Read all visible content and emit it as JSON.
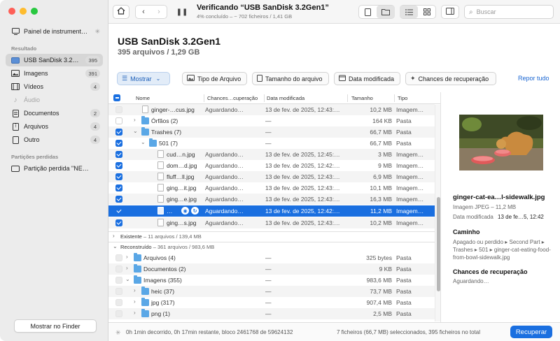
{
  "sidebar": {
    "dashboard": "Painel de instrument…",
    "results_heading": "Resultado",
    "items": [
      {
        "label": "USB  SanDisk 3.2…",
        "count": "395"
      },
      {
        "label": "Imagens",
        "count": "391"
      },
      {
        "label": "Vídeos",
        "count": "4"
      },
      {
        "label": "Áudio",
        "count": ""
      },
      {
        "label": "Documentos",
        "count": "2"
      },
      {
        "label": "Arquivos",
        "count": "4"
      },
      {
        "label": "Outro",
        "count": "4"
      }
    ],
    "lost_heading": "Partições perdidas",
    "lost_item": "Partição perdida \"NE…",
    "finder_button": "Mostrar no Finder"
  },
  "toolbar": {
    "title": "Verificando “USB  SanDisk 3.2Gen1”",
    "subtitle": "4% concluído – ~ 702 ficheiros / 1,41 GB",
    "search_placeholder": "Buscar"
  },
  "header": {
    "title": "USB  SanDisk 3.2Gen1",
    "subtitle": "395 arquivos / 1,29 GB"
  },
  "filters": {
    "show": "Mostrar",
    "type": "Tipo de Arquivo",
    "size": "Tamanho do arquivo",
    "date": "Data modificada",
    "chance": "Chances de recuperação",
    "reset": "Repor tudo"
  },
  "table": {
    "columns": {
      "name": "Nome",
      "chance": "Chances…cuperação",
      "date": "Data modificada",
      "size": "Tamanho",
      "type": "Tipo"
    },
    "rows": [
      {
        "name": "ginger-…cus.jpg",
        "chance": "Aguardando…",
        "date": "13 de fev. de 2025, 12:43:…",
        "size": "10,2 MB",
        "type": "Imagem…"
      },
      {
        "name": "Órfãos (2)",
        "chance": "",
        "date": "—",
        "size": "164 KB",
        "type": "Pasta"
      },
      {
        "name": "Trashes (7)",
        "chance": "",
        "date": "—",
        "size": "66,7 MB",
        "type": "Pasta"
      },
      {
        "name": "501 (7)",
        "chance": "",
        "date": "—",
        "size": "66,7 MB",
        "type": "Pasta"
      },
      {
        "name": "cud…n.jpg",
        "chance": "Aguardando…",
        "date": "13 de fev. de 2025, 12:45:…",
        "size": "3 MB",
        "type": "Imagem…"
      },
      {
        "name": "dom…d.jpg",
        "chance": "Aguardando…",
        "date": "13 de fev. de 2025, 12:42:…",
        "size": "9 MB",
        "type": "Imagem…"
      },
      {
        "name": "fluff…ll.jpg",
        "chance": "Aguardando…",
        "date": "13 de fev. de 2025, 12:43:…",
        "size": "6,9 MB",
        "type": "Imagem…"
      },
      {
        "name": "ging…it.jpg",
        "chance": "Aguardando…",
        "date": "13 de fev. de 2025, 12:43:…",
        "size": "10,1 MB",
        "type": "Imagem…"
      },
      {
        "name": "ging…e.jpg",
        "chance": "Aguardando…",
        "date": "13 de fev. de 2025, 12:43:…",
        "size": "16,3 MB",
        "type": "Imagem…"
      },
      {
        "name": "…",
        "chance": "Aguardando…",
        "date": "13 de fev. de 2025, 12:42:…",
        "size": "11,2 MB",
        "type": "Imagem…"
      },
      {
        "name": "ging…s.jpg",
        "chance": "Aguardando…",
        "date": "13 de fev. de 2025, 12:43:…",
        "size": "10,2 MB",
        "type": "Imagem…"
      }
    ],
    "group_existing": {
      "label": "Existente",
      "detail": " – 11 arquivos / 139,4 MB"
    },
    "group_rebuilt": {
      "label": "Reconstruído",
      "detail": " – 361 arquivos / 983,6 MB"
    },
    "rebuilt_rows": [
      {
        "name": "Arquivos (4)",
        "date": "—",
        "size": "325 bytes",
        "type": "Pasta"
      },
      {
        "name": "Documentos (2)",
        "date": "—",
        "size": "9 KB",
        "type": "Pasta"
      },
      {
        "name": "Imagens (355)",
        "date": "—",
        "size": "983,6 MB",
        "type": "Pasta"
      },
      {
        "name": "heic (37)",
        "date": "—",
        "size": "73,7 MB",
        "type": "Pasta"
      },
      {
        "name": "jpg (317)",
        "date": "—",
        "size": "907,4 MB",
        "type": "Pasta"
      },
      {
        "name": "png (1)",
        "date": "—",
        "size": "2,5 MB",
        "type": "Pasta"
      }
    ]
  },
  "preview": {
    "name": "ginger-cat-ea…l-sidewalk.jpg",
    "kind": "Imagem JPEG – 11,2 MB",
    "modified_label": "Data modificada",
    "modified_value": "13 de fe…5, 12:42",
    "path_heading": "Caminho",
    "path": "Apagado ou perdido ▸ Second Part ▸ Trashes ▸ 501 ▸ ginger-cat-eating-food-from-bowl-sidewalk.jpg",
    "chance_heading": "Chances de recuperação",
    "chance_value": "Aguardando…"
  },
  "status": {
    "left": "0h 1min decorrido, 0h 17min restante, bloco 2461768 de 59624132",
    "right": "7 ficheiros (66,7 MB) seleccionados, 395 ficheiros no total",
    "recover": "Recuperar"
  },
  "colors": {
    "accent": "#1a6fe0",
    "folder": "#5aa7e6"
  }
}
